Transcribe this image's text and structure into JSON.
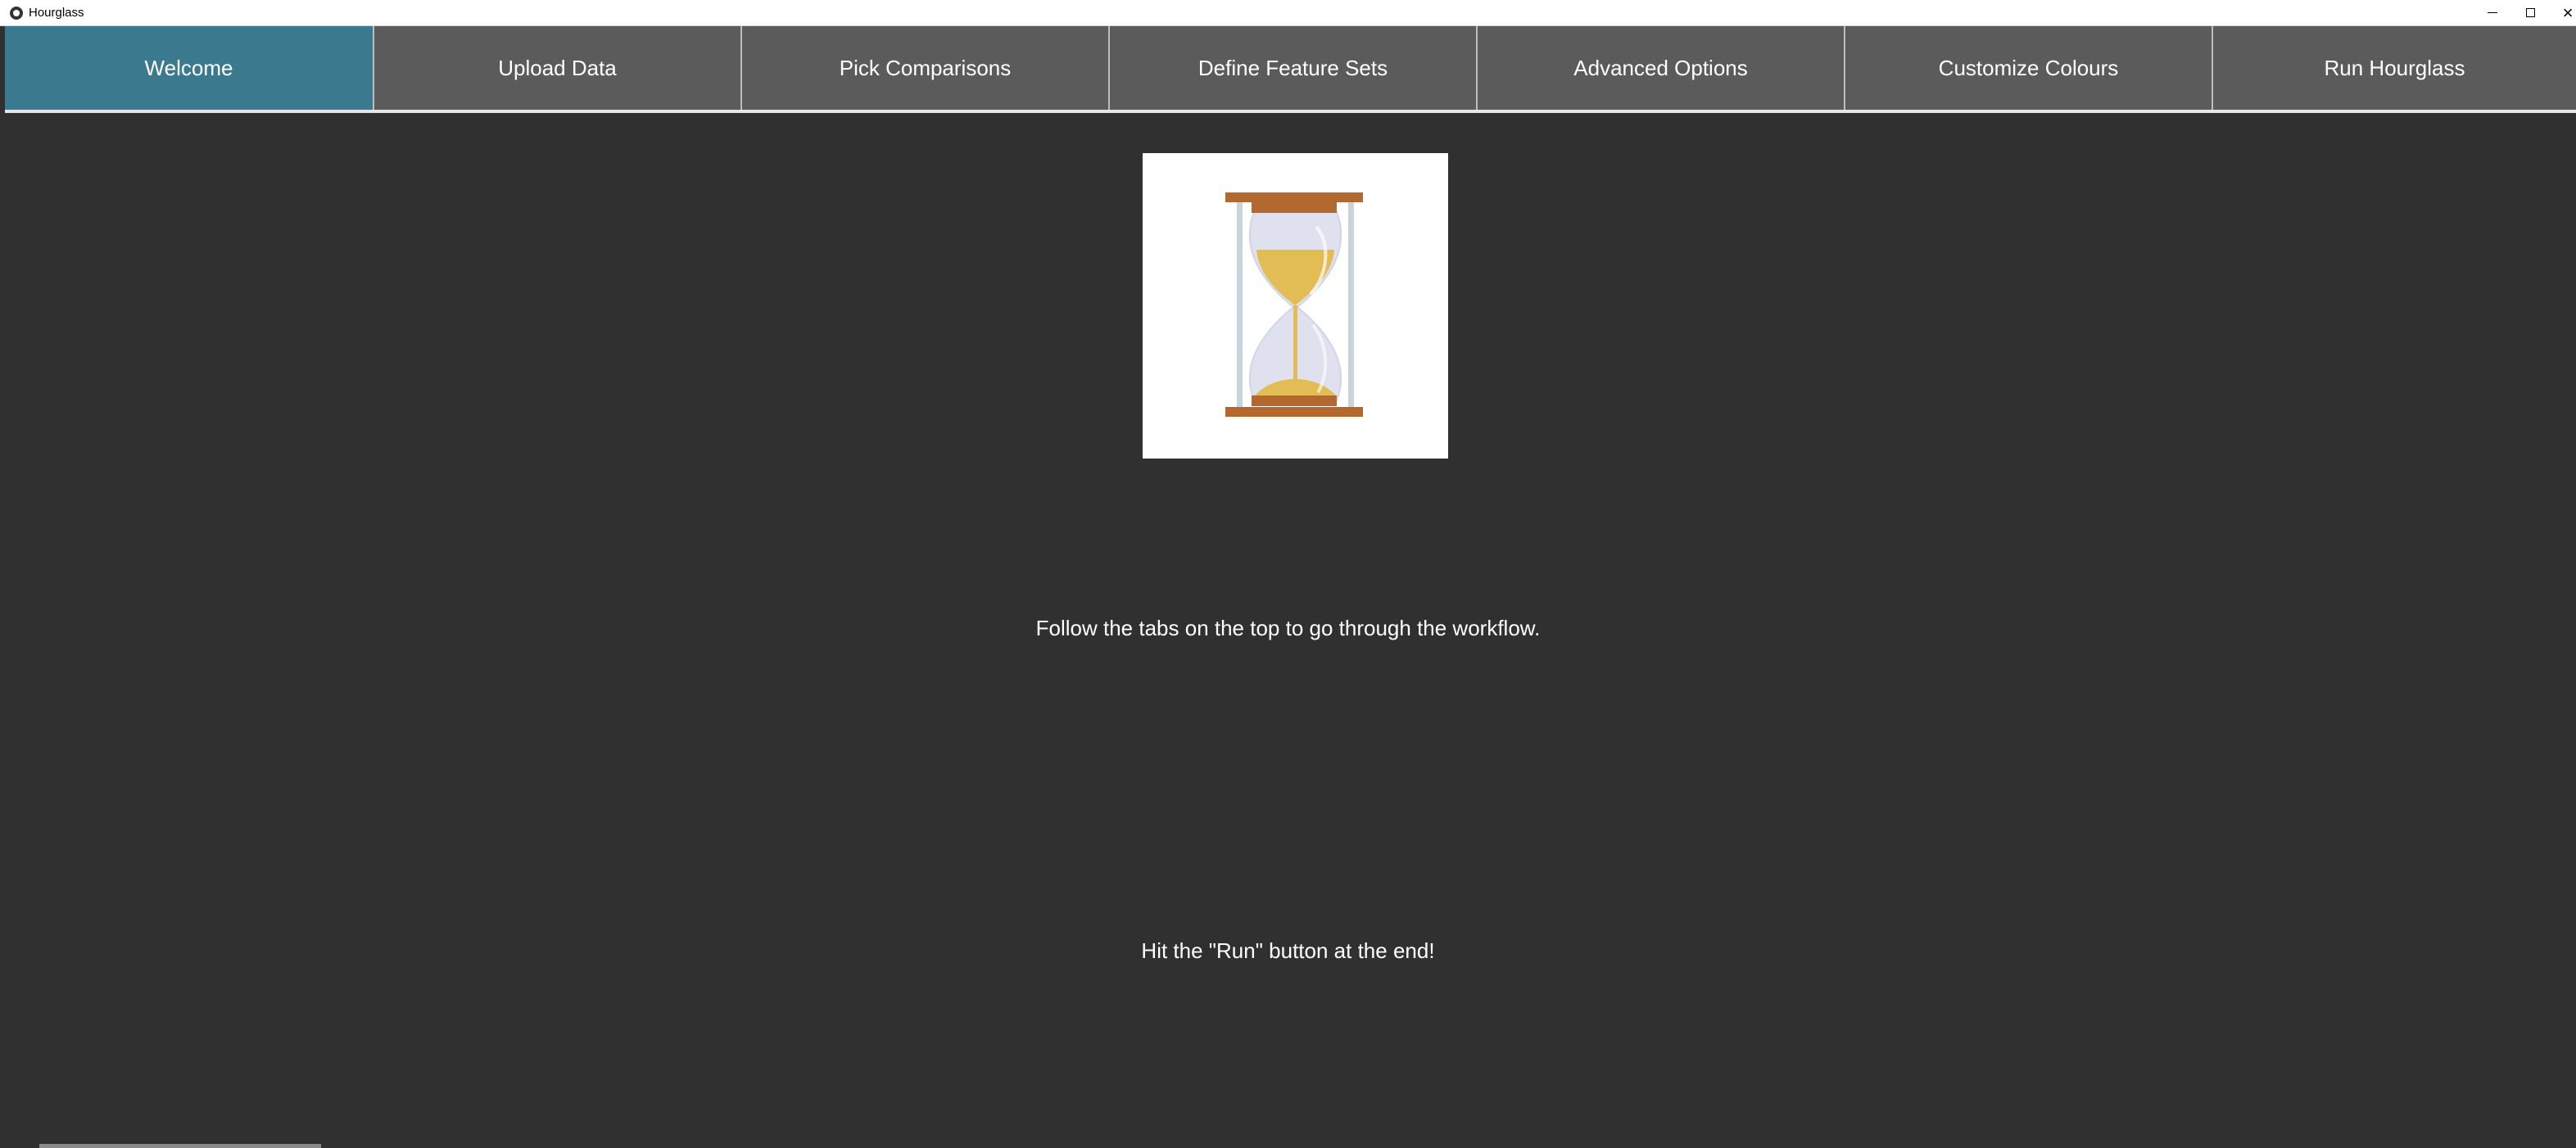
{
  "window": {
    "title": "Hourglass"
  },
  "tabs": [
    {
      "label": "Welcome",
      "active": true
    },
    {
      "label": "Upload Data",
      "active": false
    },
    {
      "label": "Pick Comparisons",
      "active": false
    },
    {
      "label": "Define Feature Sets",
      "active": false
    },
    {
      "label": "Advanced Options",
      "active": false
    },
    {
      "label": "Customize Colours",
      "active": false
    },
    {
      "label": "Run Hourglass",
      "active": false
    }
  ],
  "welcome": {
    "logo_icon": "hourglass-icon",
    "instruction": "Follow the tabs on the top to go through the workflow.",
    "hint": "Hit the \"Run\" button at the end!"
  },
  "colors": {
    "active_tab": "#3b7a8e",
    "inactive_tab": "#5b5b5b",
    "background": "#303030"
  }
}
